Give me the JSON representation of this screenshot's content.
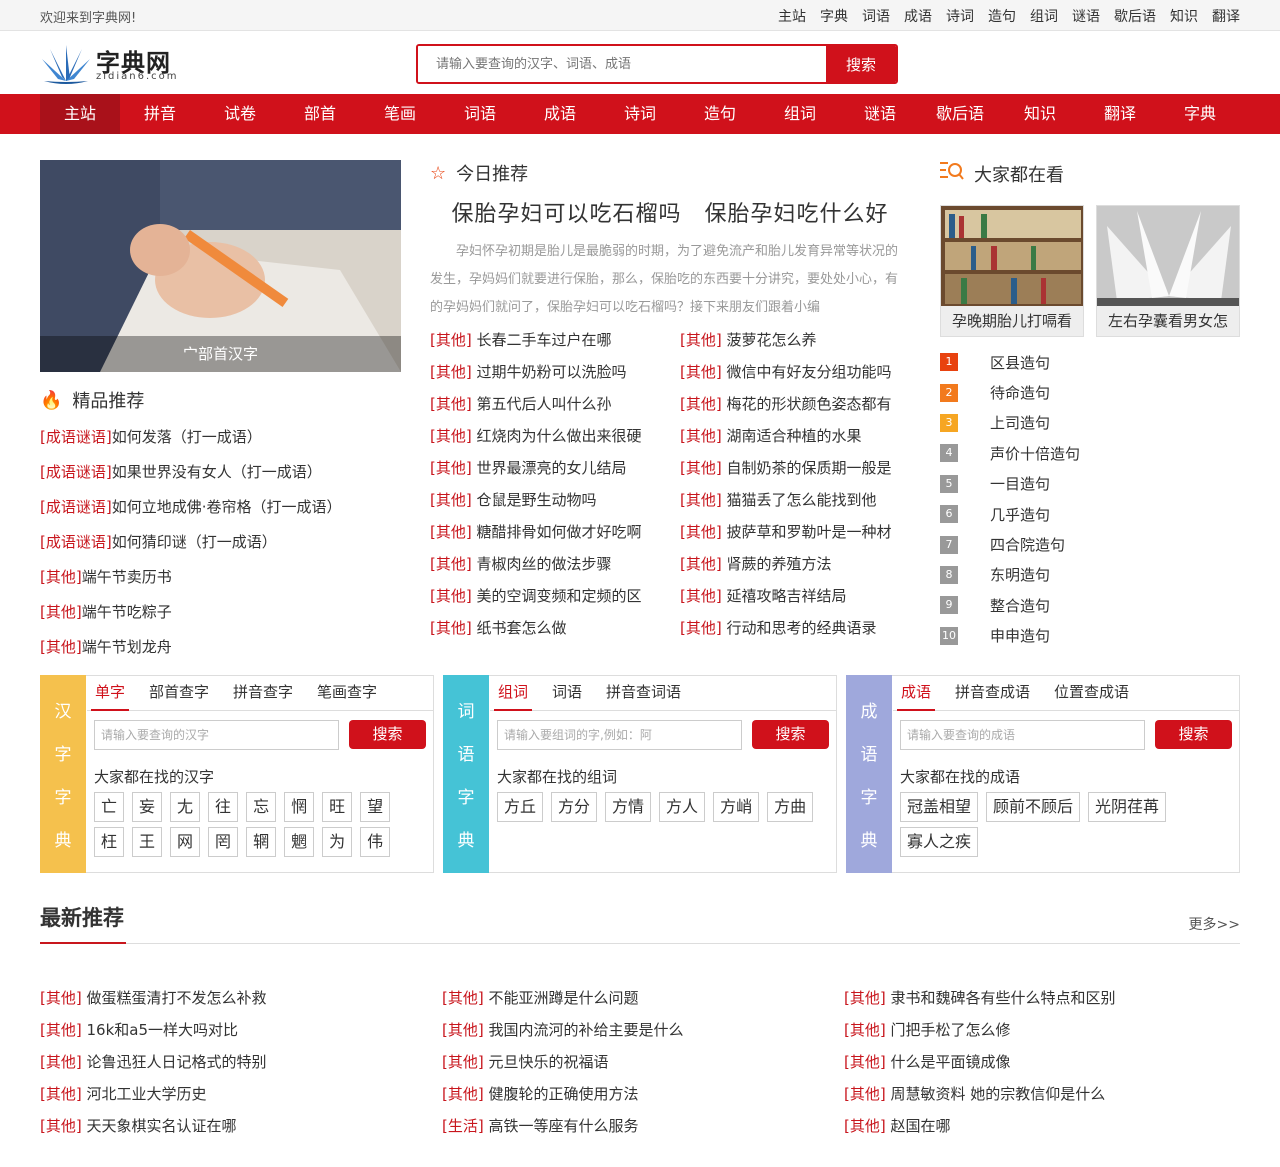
{
  "topbar": {
    "welcome": "欢迎来到字典网!",
    "links": [
      "主站",
      "字典",
      "词语",
      "成语",
      "诗词",
      "造句",
      "组词",
      "谜语",
      "歇后语",
      "知识",
      "翻译"
    ]
  },
  "logo": {
    "name": "字典网",
    "domain": "zidian6.com"
  },
  "search": {
    "placeholder": "请输入要查询的汉字、词语、成语",
    "button": "搜索"
  },
  "nav": [
    "主站",
    "拼音",
    "试卷",
    "部首",
    "笔画",
    "词语",
    "成语",
    "诗词",
    "造句",
    "组词",
    "谜语",
    "歇后语",
    "知识",
    "翻译",
    "字典"
  ],
  "hero": {
    "caption": "宀部首汉字"
  },
  "jingpin": {
    "title": "精品推荐",
    "items": [
      {
        "tag": "[成语谜语]",
        "text": "如何发落（打一成语）"
      },
      {
        "tag": "[成语谜语]",
        "text": "如果世界没有女人（打一成语）"
      },
      {
        "tag": "[成语谜语]",
        "text": "如何立地成佛·卷帘格（打一成语）"
      },
      {
        "tag": "[成语谜语]",
        "text": "如何猜印谜（打一成语）"
      },
      {
        "tag": "[其他]",
        "text": "端午节卖历书"
      },
      {
        "tag": "[其他]",
        "text": "端午节吃粽子"
      },
      {
        "tag": "[其他]",
        "text": "端午节划龙舟"
      }
    ]
  },
  "today": {
    "title": "今日推荐",
    "headline": "保胎孕妇可以吃石榴吗　保胎孕妇吃什么好",
    "summary": "孕妇怀孕初期是胎儿是最脆弱的时期，为了避免流产和胎儿发育异常等状况的发生，孕妈妈们就要进行保胎，那么，保胎吃的东西要十分讲究，要处处小心，有的孕妈妈们就问了，保胎孕妇可以吃石榴吗？接下来朋友们跟着小编",
    "items": [
      {
        "tag": "[其他]",
        "text": "长春二手车过户在哪"
      },
      {
        "tag": "[其他]",
        "text": "菠萝花怎么养"
      },
      {
        "tag": "[其他]",
        "text": "过期牛奶粉可以洗脸吗"
      },
      {
        "tag": "[其他]",
        "text": "微信中有好友分组功能吗"
      },
      {
        "tag": "[其他]",
        "text": "第五代后人叫什么孙"
      },
      {
        "tag": "[其他]",
        "text": "梅花的形状颜色姿态都有"
      },
      {
        "tag": "[其他]",
        "text": "红烧肉为什么做出来很硬"
      },
      {
        "tag": "[其他]",
        "text": "湖南适合种植的水果"
      },
      {
        "tag": "[其他]",
        "text": "世界最漂亮的女儿结局"
      },
      {
        "tag": "[其他]",
        "text": "自制奶茶的保质期一般是"
      },
      {
        "tag": "[其他]",
        "text": "仓鼠是野生动物吗"
      },
      {
        "tag": "[其他]",
        "text": "猫猫丢了怎么能找到他"
      },
      {
        "tag": "[其他]",
        "text": "糖醋排骨如何做才好吃啊"
      },
      {
        "tag": "[其他]",
        "text": "披萨草和罗勒叶是一种材"
      },
      {
        "tag": "[其他]",
        "text": "青椒肉丝的做法步骤"
      },
      {
        "tag": "[其他]",
        "text": "肾蕨的养殖方法"
      },
      {
        "tag": "[其他]",
        "text": "美的空调变频和定频的区"
      },
      {
        "tag": "[其他]",
        "text": "延禧攻略吉祥结局"
      },
      {
        "tag": "[其他]",
        "text": "纸书套怎么做"
      },
      {
        "tag": "[其他]",
        "text": "行动和思考的经典语录"
      }
    ]
  },
  "watching": {
    "title": "大家都在看",
    "pics": [
      "孕晚期胎儿打嗝看",
      "左右孕囊看男女怎"
    ],
    "rank": [
      "区县造句",
      "待命造句",
      "上司造句",
      "声价十倍造句",
      "一目造句",
      "几乎造句",
      "四合院造句",
      "东明造句",
      "整合造句",
      "申申造句"
    ],
    "rank_nums": [
      "1",
      "2",
      "3",
      "4",
      "5",
      "6",
      "7",
      "8",
      "9",
      "10"
    ]
  },
  "boxes": [
    {
      "side": [
        "汉",
        "字",
        "字",
        "典"
      ],
      "color": "#f5c14d",
      "tabs": [
        "单字",
        "部首查字",
        "拼音查字",
        "笔画查字"
      ],
      "placeholder": "请输入要查询的汉字",
      "button": "搜索",
      "look": "大家都在找的汉字",
      "chips": [
        "亡",
        "妄",
        "尢",
        "往",
        "忘",
        "惘",
        "旺",
        "望",
        "枉",
        "王",
        "网",
        "罔",
        "辋",
        "魍",
        "为",
        "伟"
      ]
    },
    {
      "side": [
        "词",
        "语",
        "字",
        "典"
      ],
      "color": "#45c3d6",
      "tabs": [
        "组词",
        "词语",
        "拼音查词语"
      ],
      "placeholder": "请输入要组词的字,例如：阿",
      "button": "搜索",
      "look": "大家都在找的组词",
      "chips": [
        "方丘",
        "方分",
        "方情",
        "方人",
        "方峭",
        "方曲"
      ]
    },
    {
      "side": [
        "成",
        "语",
        "字",
        "典"
      ],
      "color": "#9fa8dc",
      "tabs": [
        "成语",
        "拼音查成语",
        "位置查成语"
      ],
      "placeholder": "请输入要查询的成语",
      "button": "搜索",
      "look": "大家都在找的成语",
      "chips": [
        "冠盖相望",
        "顾前不顾后",
        "光阴荏苒",
        "寡人之疾"
      ]
    }
  ],
  "latest": {
    "title": "最新推荐",
    "more": "更多>>",
    "cols": [
      [
        {
          "tag": "[其他]",
          "text": "做蛋糕蛋清打不发怎么补救"
        },
        {
          "tag": "[其他]",
          "text": "16k和a5一样大吗对比"
        },
        {
          "tag": "[其他]",
          "text": "论鲁迅狂人日记格式的特别"
        },
        {
          "tag": "[其他]",
          "text": "河北工业大学历史"
        },
        {
          "tag": "[其他]",
          "text": "天天象棋实名认证在哪"
        }
      ],
      [
        {
          "tag": "[其他]",
          "text": "不能亚洲蹲是什么问题"
        },
        {
          "tag": "[其他]",
          "text": "我国内流河的补给主要是什么"
        },
        {
          "tag": "[其他]",
          "text": "元旦快乐的祝福语"
        },
        {
          "tag": "[其他]",
          "text": "健腹轮的正确使用方法"
        },
        {
          "tag": "[生活]",
          "text": "高铁一等座有什么服务"
        }
      ],
      [
        {
          "tag": "[其他]",
          "text": "隶书和魏碑各有些什么特点和区别"
        },
        {
          "tag": "[其他]",
          "text": "门把手松了怎么修"
        },
        {
          "tag": "[其他]",
          "text": "什么是平面镜成像"
        },
        {
          "tag": "[其他]",
          "text": "周慧敏资料 她的宗教信仰是什么"
        },
        {
          "tag": "[其他]",
          "text": "赵国在哪"
        }
      ]
    ]
  }
}
